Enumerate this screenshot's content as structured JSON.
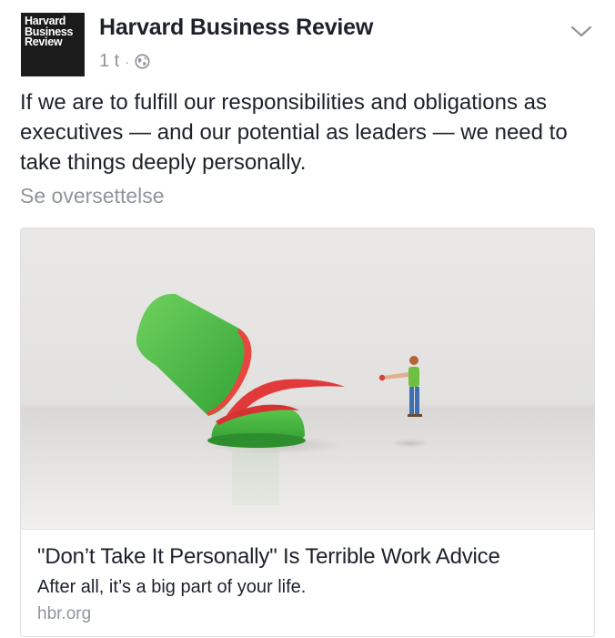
{
  "page": {
    "logo_lines": [
      "Harvard",
      "Business",
      "Review"
    ],
    "name": "Harvard Business Review",
    "time": "1 t",
    "separator": "·",
    "privacy_icon": "globe-icon",
    "menu_icon": "chevron-down-icon"
  },
  "post": {
    "text": "If we are to fulfill our responsibilities and obligations as executives — and our potential as leaders — we need to take things deeply personally.",
    "translate_label": "Se oversettelse"
  },
  "link": {
    "title": "\"Don’t Take It Personally\" Is Terrible Work Advice",
    "description": "After all, it’s a big part of your life.",
    "domain": "hbr.org"
  },
  "colors": {
    "text": "#1d2129",
    "secondary": "#90949c",
    "border": "#dddfe2",
    "logo_bg": "#1b1b1b",
    "illustration_green": "#45b83f",
    "illustration_red": "#e23a3a"
  }
}
